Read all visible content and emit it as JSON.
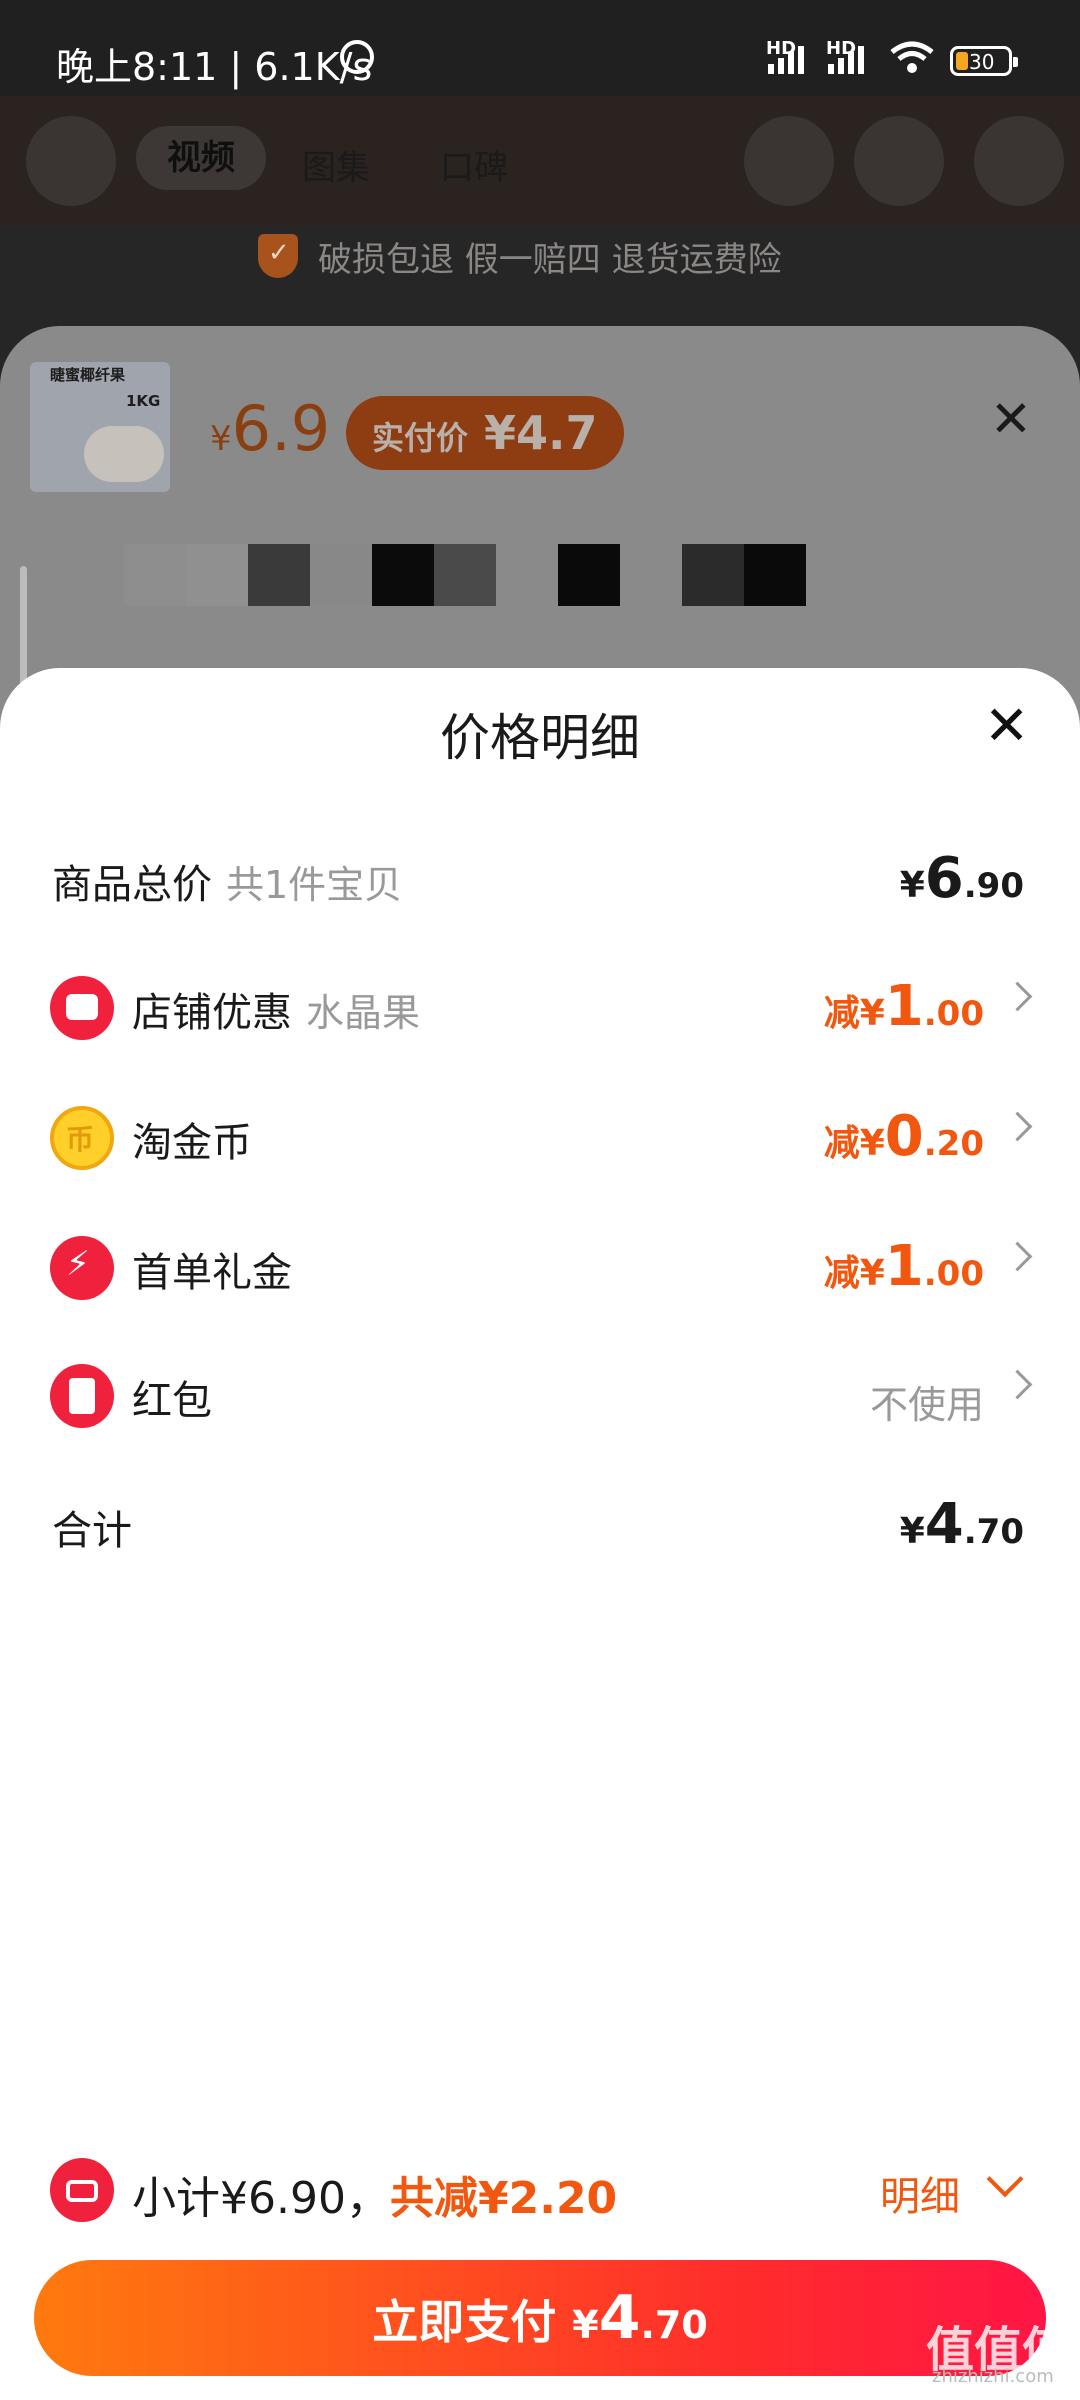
{
  "status_bar": {
    "time": "晚上8:11 | 6.1K/s",
    "signal1": "HD",
    "signal2": "HD",
    "battery": "30"
  },
  "background_page": {
    "tabs": [
      "视频",
      "图集",
      "口碑"
    ],
    "guarantee": "破损包退 假一赔四 退货运费险",
    "product_image_text": [
      "睫蜜椰纤果",
      "1KG"
    ],
    "price_symbol": "¥",
    "price": "6.9",
    "actual_label": "实付价",
    "actual_price": "¥4.7"
  },
  "sheet": {
    "title": "价格明细",
    "rows": [
      {
        "label": "商品总价",
        "sub": "共1件宝贝",
        "prefix": "",
        "yen": "¥",
        "int": "6",
        "dec": ".90"
      },
      {
        "label": "店铺优惠",
        "sub": "水晶果",
        "prefix": "减",
        "yen": "¥",
        "int": "1",
        "dec": ".00"
      },
      {
        "label": "淘金币",
        "sub": "",
        "prefix": "减",
        "yen": "¥",
        "int": "0",
        "dec": ".20"
      },
      {
        "label": "首单礼金",
        "sub": "",
        "prefix": "减",
        "yen": "¥",
        "int": "1",
        "dec": ".00"
      },
      {
        "label": "红包",
        "sub": "",
        "muted": "不使用"
      },
      {
        "label": "合计",
        "sub": "",
        "prefix": "",
        "yen": "¥",
        "int": "4",
        "dec": ".70"
      }
    ]
  },
  "bottom_bar": {
    "subtotal": "小计¥6.90，",
    "saved": "共减¥2.20",
    "detail": "明细"
  },
  "pay_button": {
    "label": "立即支付",
    "yen": "¥",
    "int": "4",
    "dec": ".70"
  },
  "watermark": {
    "main": "值值值",
    "sub": "zhizhizhi.com"
  },
  "colors": {
    "accent": "#f2570f",
    "brand_red": "#f0213d"
  }
}
